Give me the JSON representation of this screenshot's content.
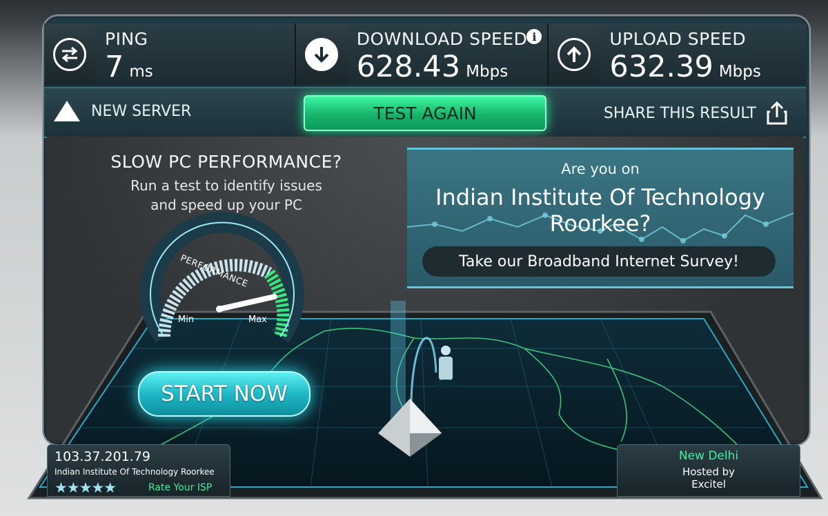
{
  "stats": {
    "ping": {
      "label": "PING",
      "value": "7",
      "unit": "ms"
    },
    "download": {
      "label": "DOWNLOAD SPEED",
      "value": "628.43",
      "unit": "Mbps",
      "info": "i"
    },
    "upload": {
      "label": "UPLOAD SPEED",
      "value": "632.39",
      "unit": "Mbps"
    }
  },
  "actions": {
    "new_server": "NEW SERVER",
    "test_again": "TEST AGAIN",
    "share": "SHARE THIS RESULT"
  },
  "promo": {
    "title": "SLOW PC PERFORMANCE?",
    "line1": "Run a test to identify issues",
    "line2": "and speed up your PC",
    "gauge_label": "PERFORMANCE",
    "gauge_min": "Min",
    "gauge_max": "Max",
    "start": "START NOW"
  },
  "ad": {
    "question": "Are you on",
    "name_line1": "Indian Institute Of Technology",
    "name_line2": "Roorkee?",
    "survey": "Take our Broadband Internet Survey!"
  },
  "isp": {
    "ip": "103.37.201.79",
    "org": "Indian Institute Of Technology Roorkee",
    "stars": "★★★★★",
    "rate": "Rate Your ISP"
  },
  "server": {
    "city": "New Delhi",
    "hosted": "Hosted by",
    "host": "Excitel"
  },
  "colors": {
    "accent_green": "#25e88f",
    "accent_cyan": "#27d7e6",
    "panel": "#1b2b32"
  }
}
